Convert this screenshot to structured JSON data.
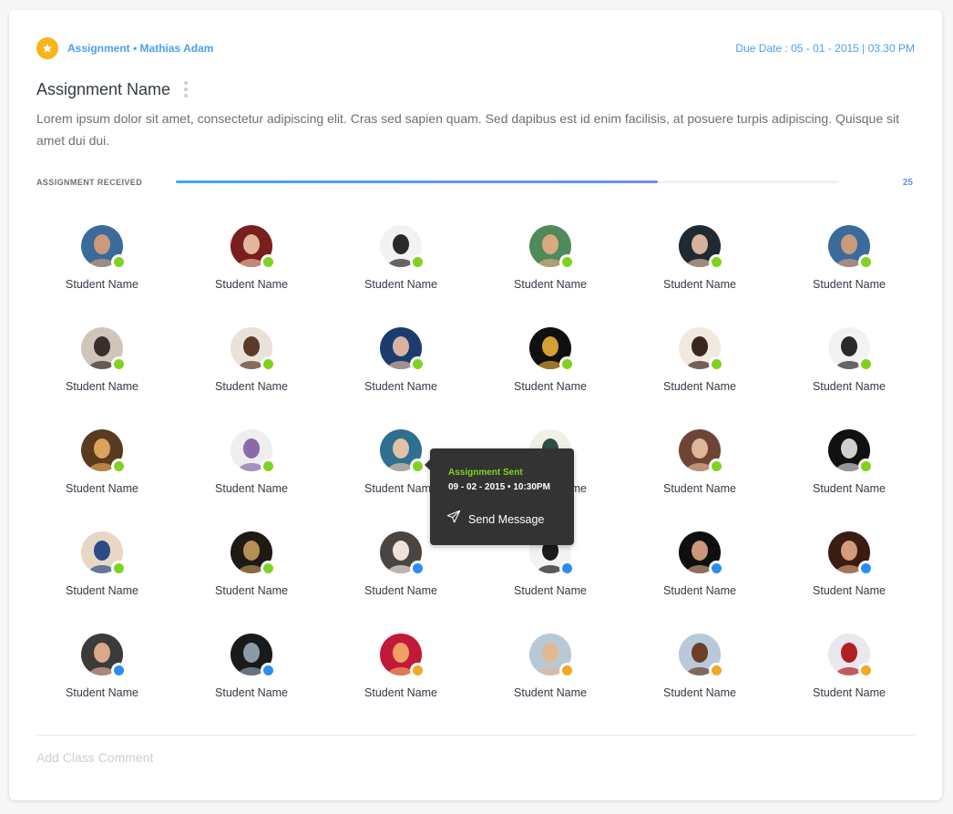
{
  "header": {
    "icon": "star-icon",
    "meta": "Assignment • Mathias Adam",
    "due_date": "Due Date : 05 - 01 - 2015 | 03.30 PM"
  },
  "assignment": {
    "title": "Assignment Name",
    "description": "Lorem ipsum dolor sit amet, consectetur adipiscing elit. Cras sed sapien quam. Sed dapibus est id enim facilisis, at posuere turpis adipiscing. Quisque sit amet dui dui."
  },
  "progress": {
    "label": "ASSIGNMENT RECEIVED",
    "percent": 72.7,
    "count": "25"
  },
  "status_colors": {
    "sent": "#7ed321",
    "received": "#2a8ef0",
    "pending": "#f5a623"
  },
  "students": [
    {
      "name": "Student Name",
      "status": "sent",
      "tone": [
        "#3b6b9a",
        "#c99a7c"
      ]
    },
    {
      "name": "Student Name",
      "status": "sent",
      "tone": [
        "#7a1e1e",
        "#e3b59c"
      ]
    },
    {
      "name": "Student Name",
      "status": "sent",
      "tone": [
        "#f2f2f2",
        "#2a2a2a"
      ]
    },
    {
      "name": "Student Name",
      "status": "sent",
      "tone": [
        "#4f8a5a",
        "#d9a980"
      ]
    },
    {
      "name": "Student Name",
      "status": "sent",
      "tone": [
        "#1f2a33",
        "#d6b39a"
      ]
    },
    {
      "name": "Student Name",
      "status": "sent",
      "tone": [
        "#3b6b9a",
        "#c99a7c"
      ]
    },
    {
      "name": "Student Name",
      "status": "sent",
      "tone": [
        "#cfc6b9",
        "#3a2f2a"
      ]
    },
    {
      "name": "Student Name",
      "status": "sent",
      "tone": [
        "#e9e2d8",
        "#5a3a28"
      ]
    },
    {
      "name": "Student Name",
      "status": "sent",
      "tone": [
        "#1c3c6e",
        "#d8b3a0"
      ]
    },
    {
      "name": "Student Name",
      "status": "sent",
      "tone": [
        "#101010",
        "#d5a033"
      ]
    },
    {
      "name": "Student Name",
      "status": "sent",
      "tone": [
        "#f1e9df",
        "#3a261c"
      ]
    },
    {
      "name": "Student Name",
      "status": "sent",
      "tone": [
        "#f2f2f2",
        "#2a2a2a"
      ]
    },
    {
      "name": "Student Name",
      "status": "sent",
      "tone": [
        "#5a3b1f",
        "#d9a35a"
      ]
    },
    {
      "name": "Student Name",
      "status": "sent",
      "tone": [
        "#eeeeee",
        "#8a6aa8"
      ]
    },
    {
      "name": "Student Name",
      "status": "sent",
      "tone": [
        "#2f6f8f",
        "#e2c1a6"
      ]
    },
    {
      "name": "Student Name",
      "status": "sent",
      "tone": [
        "#f1efe6",
        "#2d4f4a"
      ]
    },
    {
      "name": "Student Name",
      "status": "sent",
      "tone": [
        "#6e4535",
        "#e0b59b"
      ]
    },
    {
      "name": "Student Name",
      "status": "sent",
      "tone": [
        "#111111",
        "#cfcfcf"
      ]
    },
    {
      "name": "Student Name",
      "status": "sent",
      "tone": [
        "#e6d8c4",
        "#2d4a86"
      ]
    },
    {
      "name": "Student Name",
      "status": "sent",
      "tone": [
        "#1e1a14",
        "#b68f55"
      ]
    },
    {
      "name": "Student Name",
      "status": "received",
      "tone": [
        "#4b4541",
        "#f0e3dc"
      ]
    },
    {
      "name": "Student Name",
      "status": "received",
      "tone": [
        "#f2f2f2",
        "#1a1a1a"
      ]
    },
    {
      "name": "Student Name",
      "status": "received",
      "tone": [
        "#0f0f0f",
        "#c9977b"
      ]
    },
    {
      "name": "Student Name",
      "status": "received",
      "tone": [
        "#3a1c12",
        "#d69b78"
      ]
    },
    {
      "name": "Student Name",
      "status": "received",
      "tone": [
        "#3b3b3b",
        "#d9a98a"
      ]
    },
    {
      "name": "Student Name",
      "status": "received",
      "tone": [
        "#1a1a1a",
        "#8a9aa8"
      ]
    },
    {
      "name": "Student Name",
      "status": "pending",
      "tone": [
        "#c0193a",
        "#f0a064"
      ]
    },
    {
      "name": "Student Name",
      "status": "pending",
      "tone": [
        "#b8c9d6",
        "#e2b894"
      ]
    },
    {
      "name": "Student Name",
      "status": "pending",
      "tone": [
        "#b9c9d9",
        "#6a3e27"
      ]
    },
    {
      "name": "Student Name",
      "status": "pending",
      "tone": [
        "#e8e8ee",
        "#b01f24"
      ]
    }
  ],
  "tooltip": {
    "status": "Assignment Sent",
    "datetime": "09 - 02 - 2015 • 10:30PM",
    "send_icon": "paper-plane-icon",
    "send_label": "Send Message"
  },
  "comment": {
    "placeholder": "Add Class Comment",
    "value": ""
  }
}
